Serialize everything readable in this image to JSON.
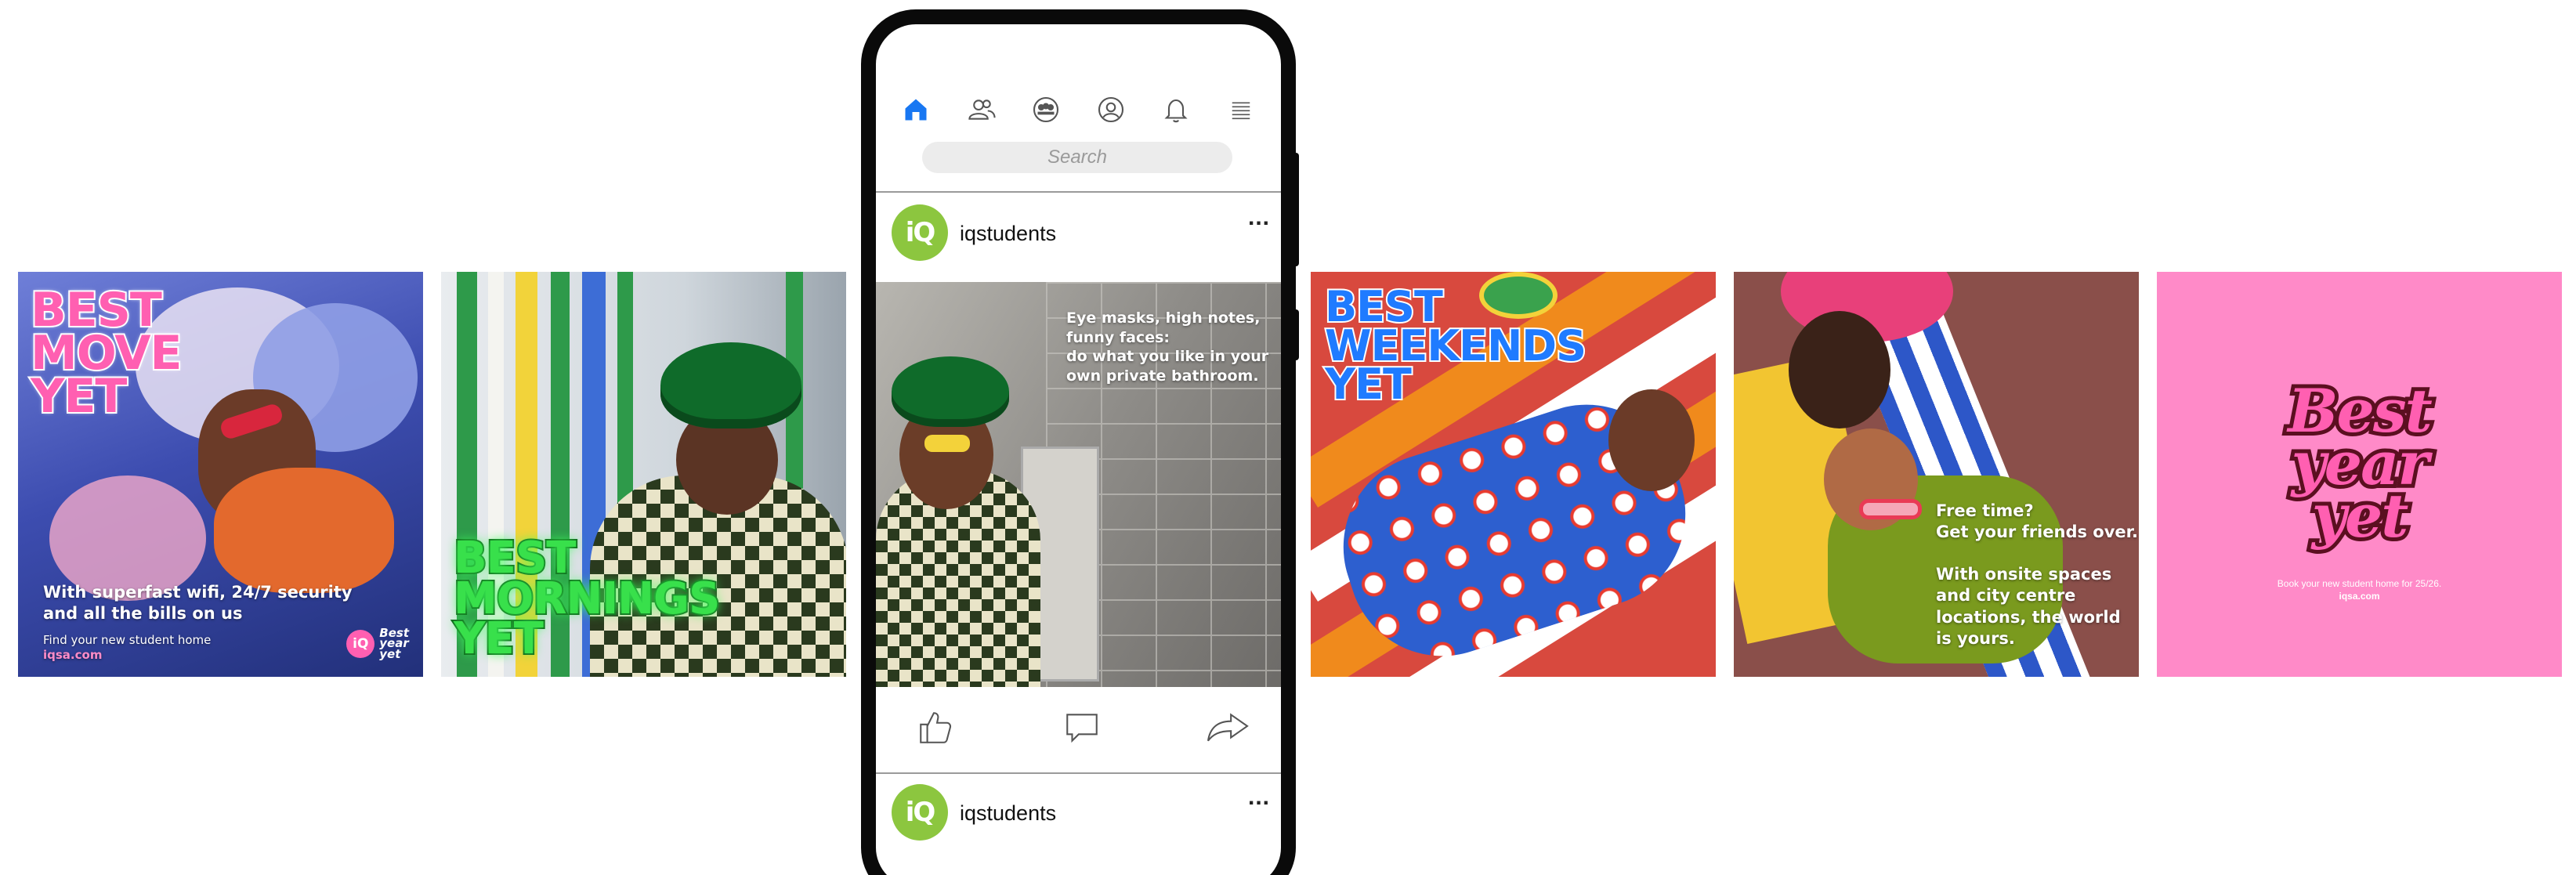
{
  "colors": {
    "brand_green": "#8cc63f",
    "brand_pink": "#ff5fb1",
    "nav_active": "#1877f2",
    "tile5_background": "#ff8ac8"
  },
  "ads": [
    {
      "headline": "BEST\nMOVE\nYET",
      "body": "With superfast wifi, 24/7 security\nand all the bills on us",
      "footer": "Find your new student home",
      "url": "iqsa.com",
      "badge_logo": "iQ",
      "badge_text": "Best\nyear\nyet"
    },
    {
      "headline": "BEST\nMORNINGS\nYET"
    },
    {
      "headline": "BEST\nWEEKENDS\nYET"
    },
    {
      "text_1": "Free time?\nGet your friends over.",
      "text_2": "With onsite spaces\nand city centre\nlocations, the world\nis yours."
    },
    {
      "headline": "Best\nyear\nyet",
      "small_1": "Book your new student home for 25/26.",
      "small_2": "iqsa.com"
    }
  ],
  "phone": {
    "nav_icons": [
      "home-icon",
      "friends-icon",
      "groups-icon",
      "profile-icon",
      "notifications-icon",
      "menu-icon"
    ],
    "search_placeholder": "Search",
    "posts": [
      {
        "avatar_logo": "iQ",
        "username": "iqstudents",
        "more": "...",
        "caption": "Eye masks, high notes,\nfunny faces:\ndo what you like in your\nown private bathroom."
      },
      {
        "avatar_logo": "iQ",
        "username": "iqstudents",
        "more": "..."
      }
    ],
    "actions": [
      "like-icon",
      "comment-icon",
      "share-icon"
    ]
  }
}
